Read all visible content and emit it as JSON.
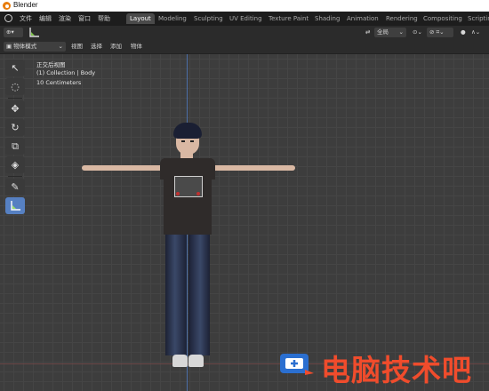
{
  "window": {
    "title": "Blender"
  },
  "menu": [
    "文件",
    "编辑",
    "渲染",
    "窗口",
    "帮助"
  ],
  "workspaces": [
    "Layout",
    "Modeling",
    "Sculpting",
    "UV Editing",
    "Texture Paint",
    "Shading",
    "Animation",
    "Rendering",
    "Compositing",
    "Scriptin"
  ],
  "active_workspace": "Layout",
  "header": {
    "orientation_label": "全局",
    "mode_label": "物体模式",
    "view_menu": [
      "视图",
      "选择",
      "添加",
      "物体"
    ]
  },
  "viewport": {
    "view_name": "正交后视图",
    "collection_info": "(1) Collection | Body",
    "scale_info": "10 Centimeters"
  },
  "tools": [
    "select-box",
    "cursor",
    "move",
    "rotate",
    "scale",
    "transform",
    "annotate",
    "measure"
  ],
  "watermark": {
    "text": "电脑技术吧"
  },
  "colors": {
    "accent": "#5680c2",
    "z_axis": "#4b6fa8",
    "watermark": "#f04c2c",
    "menu_bar": "#1d1d1d"
  }
}
